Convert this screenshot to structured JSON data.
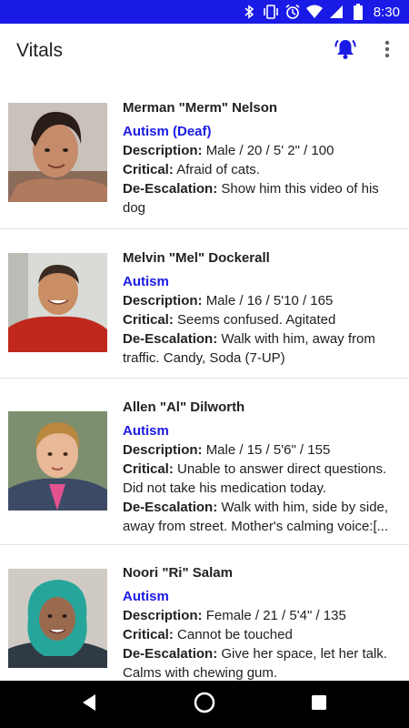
{
  "status_bar": {
    "time": "8:30",
    "icons": [
      "bluetooth-icon",
      "vibrate-icon",
      "alarm-icon",
      "wifi-icon",
      "signal-icon",
      "battery-icon"
    ],
    "background": "#1a1ae6"
  },
  "app_bar": {
    "title": "Vitals",
    "actions": [
      "bell-ringing-icon",
      "more-vert-icon"
    ],
    "accent": "#1a1ae6"
  },
  "people": [
    {
      "name": "Merman \"Merm\" Nelson",
      "condition": "Autism (Deaf)",
      "description_label": "Description:",
      "description": "Male / 20 / 5' 2\" / 100",
      "critical_label": "Critical:",
      "critical": "Afraid of cats.",
      "deescalation_label": "De-Escalation:",
      "deescalation": "Show him this video of his dog"
    },
    {
      "name": "Melvin \"Mel\" Dockerall",
      "condition": "Autism",
      "description_label": "Description:",
      "description": "Male / 16 / 5'10 / 165",
      "critical_label": "Critical:",
      "critical": "Seems confused. Agitated",
      "deescalation_label": "De-Escalation:",
      "deescalation": "Walk with him, away from traffic. Candy, Soda (7-UP)"
    },
    {
      "name": "Allen \"Al\" Dilworth",
      "condition": "Autism",
      "description_label": "Description:",
      "description": "Male / 15 / 5'6\" / 155",
      "critical_label": "Critical:",
      "critical": "Unable to answer direct questions. Did not take his medication today.",
      "deescalation_label": "De-Escalation:",
      "deescalation": "Walk with him, side by side, away from street. Mother's calming voice:[..."
    },
    {
      "name": "Noori \"Ri\" Salam",
      "condition": "Autism",
      "description_label": "Description:",
      "description": "Female / 21 / 5'4\" / 135",
      "critical_label": "Critical:",
      "critical": "Cannot be touched",
      "deescalation_label": "De-Escalation:",
      "deescalation": "Give her space, let her talk. Calms with chewing gum."
    }
  ],
  "nav_bar": {
    "buttons": [
      "back-icon",
      "home-icon",
      "recents-icon"
    ]
  }
}
